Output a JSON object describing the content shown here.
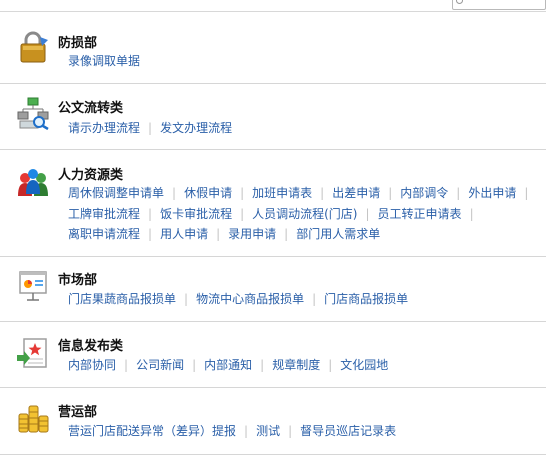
{
  "sections": [
    {
      "title": "防损部",
      "icon": "lock-icon",
      "links": [
        "录像调取单据"
      ]
    },
    {
      "title": "公文流转类",
      "icon": "workflow-search-icon",
      "links": [
        "请示办理流程",
        "发文办理流程"
      ]
    },
    {
      "title": "人力资源类",
      "icon": "people-icon",
      "links": [
        "周休假调整申请单",
        "休假申请",
        "加班申请表",
        "出差申请",
        "内部调令",
        "外出申请",
        "工牌审批流程",
        "饭卡审批流程",
        "人员调动流程(门店)",
        "员工转正申请表",
        "离职申请流程",
        "用人申请",
        "录用申请",
        "部门用人需求单"
      ]
    },
    {
      "title": "市场部",
      "icon": "presentation-icon",
      "links": [
        "门店果蔬商品报损单",
        "物流中心商品报损单",
        "门店商品报损单"
      ]
    },
    {
      "title": "信息发布类",
      "icon": "document-star-icon",
      "links": [
        "内部协同",
        "公司新闻",
        "内部通知",
        "规章制度",
        "文化园地"
      ]
    },
    {
      "title": "营运部",
      "icon": "coins-icon",
      "links": [
        "营运门店配送异常（差异）提报",
        "测试",
        "督导员巡店记录表"
      ]
    }
  ],
  "colors": {
    "link": "#2a5fa8",
    "title": "#111111",
    "divider": "#d6d6d6",
    "separator": "#c4c4c4"
  }
}
